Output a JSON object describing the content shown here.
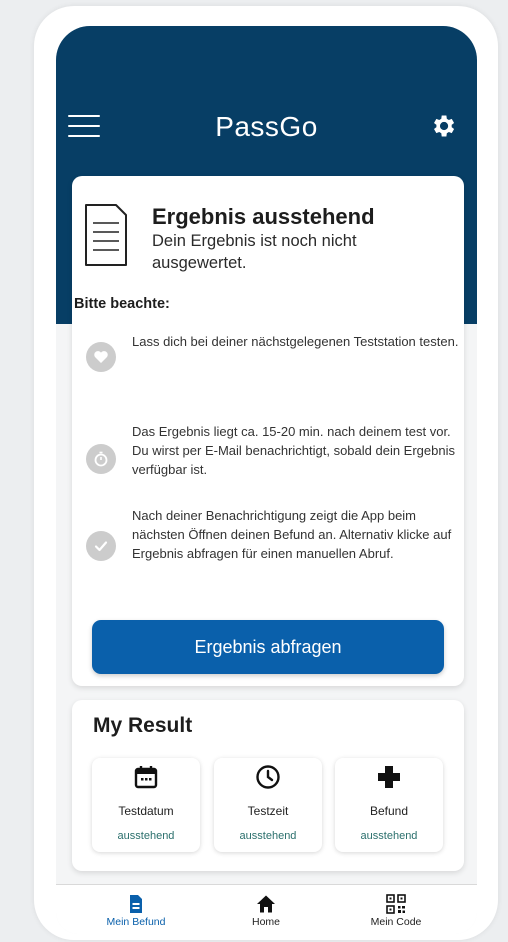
{
  "header": {
    "title": "PassGo",
    "menu_icon": "hamburger-menu-icon",
    "settings_icon": "gear-icon"
  },
  "status": {
    "icon": "document-icon",
    "title": "Ergebnis ausstehend",
    "subtitle": "Dein Ergebnis ist noch nicht ausgewertet."
  },
  "notice": {
    "title": "Bitte beachte:",
    "tips": [
      {
        "icon": "heart-icon",
        "text": "Lass dich bei deiner nächstgelegenen Teststation testen."
      },
      {
        "icon": "stopwatch-icon",
        "text": "Das Ergebnis liegt ca. 15-20 min. nach deinem test vor. Du wirst per E-Mail benachrichtigt, sobald dein Ergebnis verfügbar ist."
      },
      {
        "icon": "checkmark-icon",
        "text": "Nach deiner Benachrichtigung zeigt die App beim nächsten Öffnen deinen Befund an. Alternativ klicke auf Ergebnis abfragen für einen manuellen Abruf."
      }
    ]
  },
  "query_button_label": "Ergebnis abfragen",
  "my_result": {
    "title": "My Result",
    "tiles": [
      {
        "icon": "calendar-icon",
        "label": "Testdatum",
        "value": "ausstehend"
      },
      {
        "icon": "clock-icon",
        "label": "Testzeit",
        "value": "ausstehend"
      },
      {
        "icon": "plus-cross-icon",
        "label": "Befund",
        "value": "ausstehend"
      }
    ]
  },
  "nav": {
    "items": [
      {
        "icon": "document-nav-icon",
        "label": "Mein Befund",
        "active": true
      },
      {
        "icon": "home-icon",
        "label": "Home",
        "active": false
      },
      {
        "icon": "qr-code-icon",
        "label": "Mein Code",
        "active": false
      }
    ]
  },
  "colors": {
    "header_bg": "#073e65",
    "primary_button": "#0a60ab",
    "active_nav": "#0a60ab",
    "status_value": "#2a6f6c"
  }
}
